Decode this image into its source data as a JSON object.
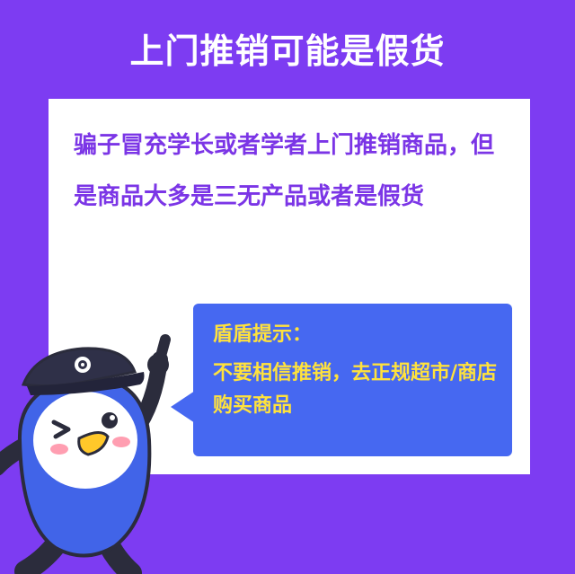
{
  "title": "上门推销可能是假货",
  "card": {
    "text": "骗子冒充学长或者学者上门推销商品，但是商品大多是三无产品或者是假货"
  },
  "tip": {
    "title": "盾盾提示：",
    "body": "不要相信推销，去正规超市/商店购买商品"
  },
  "colors": {
    "background": "#7d3cf2",
    "card": "#ffffff",
    "card_text": "#7b35e6",
    "tip_bubble": "#4668f1",
    "tip_text": "#ffe23c",
    "title_text": "#ffffff"
  },
  "icons": {
    "mascot": "police-mascot-illustration"
  }
}
